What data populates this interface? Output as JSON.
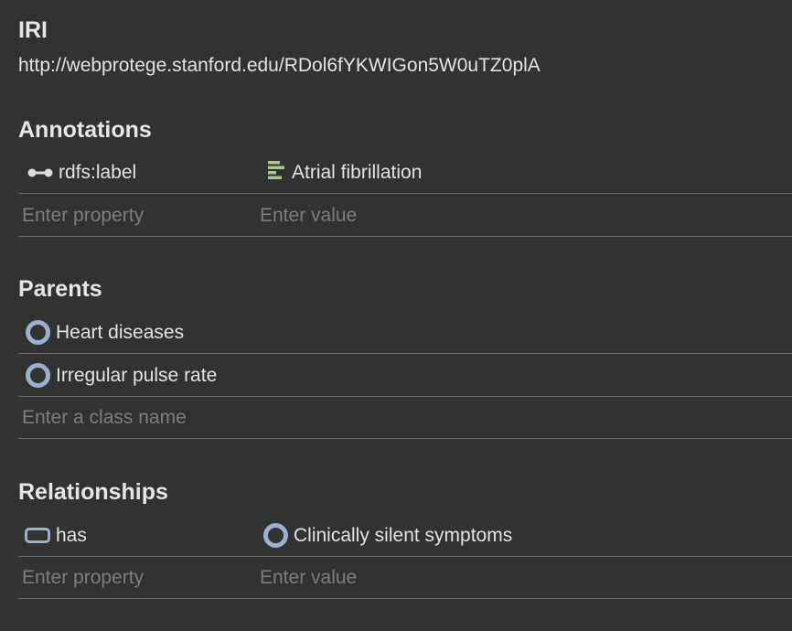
{
  "iri": {
    "heading": "IRI",
    "value": "http://webprotege.stanford.edu/RDol6fYKWIGon5W0uTZ0plA"
  },
  "annotations": {
    "heading": "Annotations",
    "rows": [
      {
        "property": "rdfs:label",
        "property_icon": "annotation-property-icon",
        "value": "Atrial fibrillation",
        "value_icon": "literal-text-icon"
      }
    ],
    "property_placeholder": "Enter property",
    "value_placeholder": "Enter value"
  },
  "parents": {
    "heading": "Parents",
    "items": [
      {
        "label": "Heart diseases",
        "icon": "class-icon"
      },
      {
        "label": "Irregular pulse rate",
        "icon": "class-icon"
      }
    ],
    "placeholder": "Enter a class name"
  },
  "relationships": {
    "heading": "Relationships",
    "rows": [
      {
        "property": "has",
        "property_icon": "object-property-icon",
        "value": "Clinically silent symptoms",
        "value_icon": "class-icon"
      }
    ],
    "property_placeholder": "Enter property",
    "value_placeholder": "Enter value"
  },
  "colors": {
    "background": "#323232",
    "text": "#e3e3e3",
    "placeholder": "#7d7d7d",
    "divider": "#6b6b6b",
    "class_icon": "#9bafcf",
    "literal_icon": "#a7c98c",
    "annotation_icon": "#dcdcdc"
  }
}
